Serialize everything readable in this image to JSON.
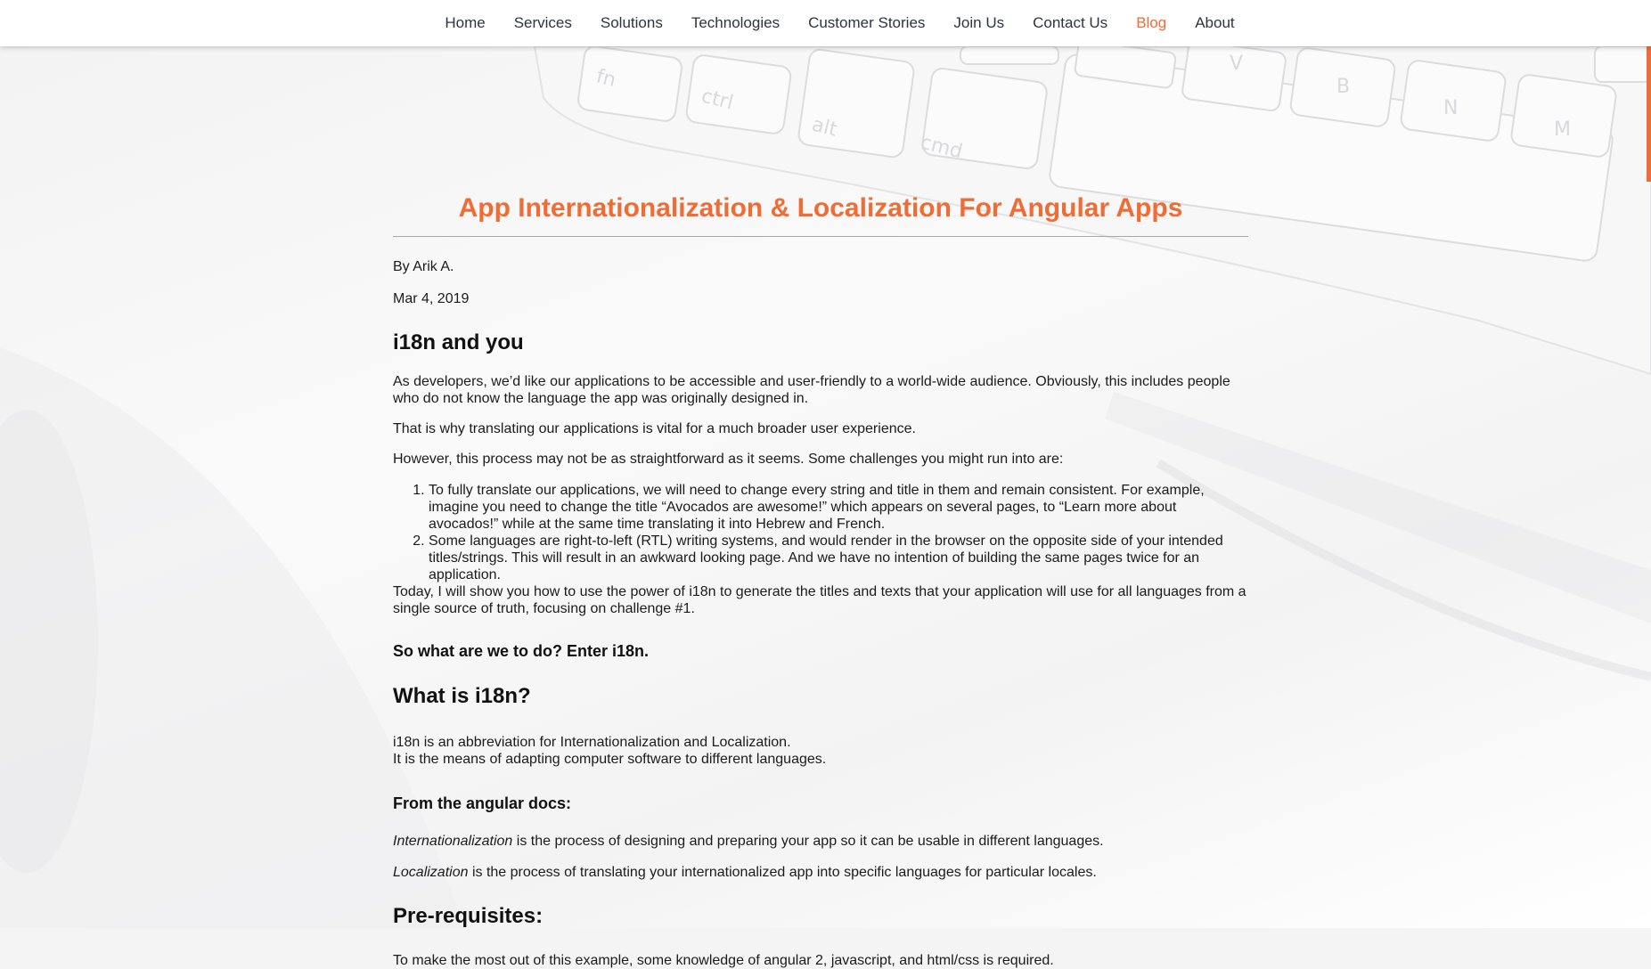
{
  "nav": {
    "items": [
      {
        "label": "Home",
        "active": false
      },
      {
        "label": "Services",
        "active": false
      },
      {
        "label": "Solutions",
        "active": false
      },
      {
        "label": "Technologies",
        "active": false
      },
      {
        "label": "Customer Stories",
        "active": false
      },
      {
        "label": "Join Us",
        "active": false
      },
      {
        "label": "Contact Us",
        "active": false
      },
      {
        "label": "Blog",
        "active": true
      },
      {
        "label": "About",
        "active": false
      }
    ]
  },
  "background": {
    "keyboard_keys": [
      "fn",
      "ctrl",
      "alt",
      "cmd",
      "V",
      "B",
      "N",
      "M"
    ]
  },
  "article": {
    "title": "App Internationalization & Localization For Angular Apps",
    "author": "By Arik A.",
    "date": "Mar 4, 2019",
    "section1": {
      "heading": "i18n and you",
      "p1": "As developers, we’d like our applications to be accessible and user-friendly to a world-wide audience. Obviously, this includes people who do not know the language the app was originally designed in.",
      "p2": "That is why translating our applications is vital for a much broader user experience.",
      "p3": "However, this process may not be as straightforward as it seems. Some challenges you might run into are:",
      "list": [
        "To fully translate our applications, we will need to change every string and title in them and remain consistent. For example, imagine you need to change the title “Avocados are awesome!” which appears on several pages, to “Learn more about avocados!” while at the same time translating it into Hebrew and French.",
        "Some languages are right-to-left (RTL) writing systems, and would render in the browser on the opposite side of your intended titles/strings. This will result in an awkward looking page. And we have no intention of building the same pages twice for an application."
      ],
      "p4": "Today, I will show you how to use the power of i18n to generate the titles and texts that your application will use for all languages from a single source of truth, focusing on challenge #1."
    },
    "subheading_enter": "So what are we to do? Enter i18n.",
    "section2": {
      "heading": "What is i18n?",
      "line1": "i18n is an abbreviation for Internationalization and Localization.",
      "line2": "It is the means of adapting computer software to different languages."
    },
    "docs": {
      "heading": "From the angular docs:",
      "term1": "Internationalization",
      "def1": " is the process of designing and preparing your app so it can be usable in different languages.",
      "term2": "Localization",
      "def2": " is the process of translating your internationalized app into specific languages for particular locales."
    },
    "prereq": {
      "heading": "Pre-requisites:",
      "text": "To make the most out of this example, some knowledge of angular 2, javascript, and html/css is required."
    }
  }
}
